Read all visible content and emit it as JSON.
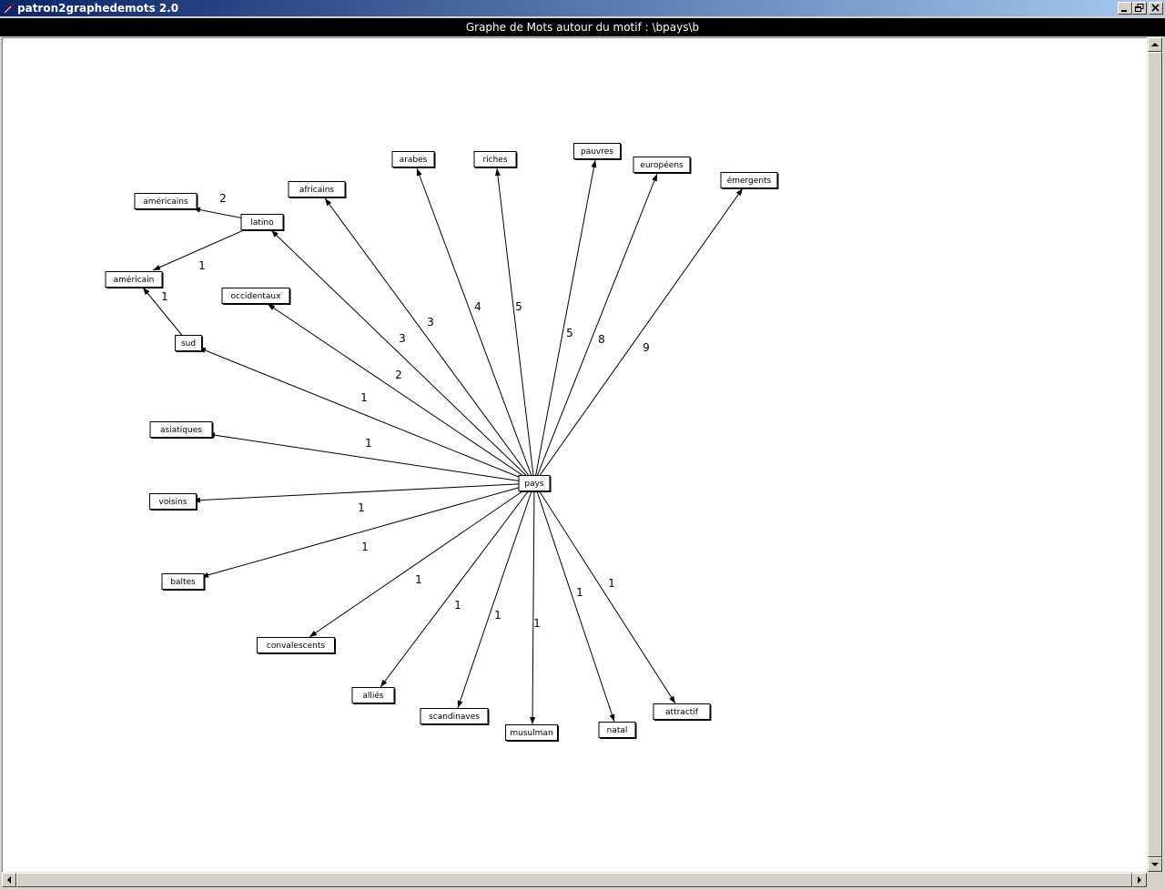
{
  "window": {
    "title": "patron2graphedemots 2.0",
    "icon": "tk-feather-icon",
    "buttons": [
      "minimize-icon",
      "restore-icon",
      "close-icon"
    ]
  },
  "header": {
    "title": "Graphe de Mots autour du motif : \\bpays\\b"
  },
  "colors": {
    "titlebar_start": "#0a246a",
    "titlebar_end": "#a6caf0",
    "header_bg": "#000000",
    "canvas_bg": "#ffffff",
    "node_border": "#000000"
  },
  "graph": {
    "center": "pays",
    "nodes": [
      "pays",
      "latino",
      "sud",
      "américains",
      "américain",
      "africains",
      "arabes",
      "riches",
      "pauvres",
      "européens",
      "émergents",
      "occidentaux",
      "asiatiques",
      "voisins",
      "baltes",
      "convalescents",
      "alliés",
      "scandinaves",
      "musulman",
      "natal",
      "attractif"
    ],
    "edges": [
      {
        "from": "pays",
        "to": "latino",
        "weight": "3"
      },
      {
        "from": "pays",
        "to": "africains",
        "weight": "3"
      },
      {
        "from": "pays",
        "to": "arabes",
        "weight": "4"
      },
      {
        "from": "pays",
        "to": "riches",
        "weight": "5"
      },
      {
        "from": "pays",
        "to": "pauvres",
        "weight": "5"
      },
      {
        "from": "pays",
        "to": "européens",
        "weight": "8"
      },
      {
        "from": "pays",
        "to": "émergents",
        "weight": "9"
      },
      {
        "from": "pays",
        "to": "occidentaux",
        "weight": "2"
      },
      {
        "from": "pays",
        "to": "sud",
        "weight": "1"
      },
      {
        "from": "pays",
        "to": "asiatiques",
        "weight": "1"
      },
      {
        "from": "pays",
        "to": "voisins",
        "weight": "1"
      },
      {
        "from": "pays",
        "to": "baltes",
        "weight": "1"
      },
      {
        "from": "pays",
        "to": "convalescents",
        "weight": "1"
      },
      {
        "from": "pays",
        "to": "alliés",
        "weight": "1"
      },
      {
        "from": "pays",
        "to": "scandinaves",
        "weight": "1"
      },
      {
        "from": "pays",
        "to": "musulman",
        "weight": "1"
      },
      {
        "from": "pays",
        "to": "natal",
        "weight": "1"
      },
      {
        "from": "pays",
        "to": "attractif",
        "weight": "1"
      },
      {
        "from": "latino",
        "to": "américains",
        "weight": "2"
      },
      {
        "from": "latino",
        "to": "américain",
        "weight": "1"
      },
      {
        "from": "sud",
        "to": "américain",
        "weight": "1"
      }
    ]
  }
}
